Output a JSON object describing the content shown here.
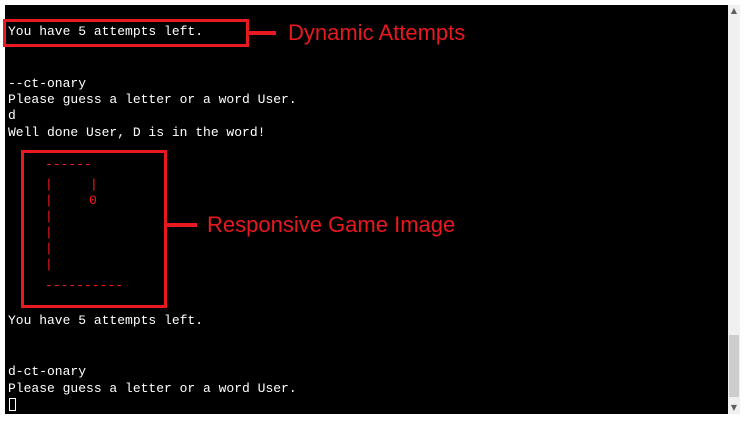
{
  "terminal": {
    "attempts_line_1": "You have 5 attempts left.",
    "masked_word_1": "--ct-onary",
    "prompt_1": "Please guess a letter or a word User.",
    "input_1": "d",
    "feedback_1": "Well done User, D is in the word!",
    "attempts_line_2": "You have 5 attempts left.",
    "masked_word_2": "d-ct-onary",
    "prompt_2": "Please guess a letter or a word User."
  },
  "hangman": {
    "top_bar": "------",
    "post": "|",
    "rope": "|",
    "head": "0",
    "base": "----------"
  },
  "annotations": {
    "attempts_callout": "Dynamic Attempts",
    "image_callout": "Responsive Game Image"
  },
  "colors": {
    "terminal_bg": "#000000",
    "terminal_text": "#ffffff",
    "hangman": "#ff1a1a",
    "annotation": "#e8191f"
  }
}
